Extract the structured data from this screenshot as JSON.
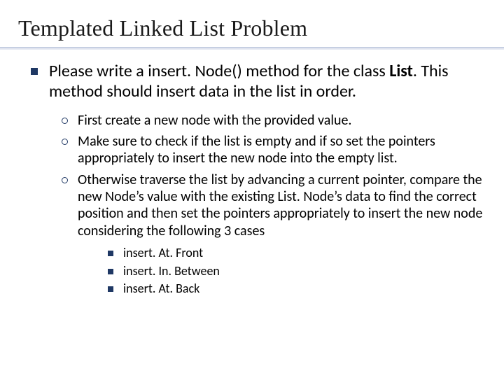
{
  "title": "Templated Linked List Problem",
  "intro_pre": "Please write a insert. Node() method for the class ",
  "intro_bold": "List",
  "intro_post": ". This method should insert data in the list in order.",
  "sub": {
    "a": "First create a new node with the provided value.",
    "b": "Make sure to check if the list is empty and if so set the pointers appropriately to insert the new node into the empty list.",
    "c": "Otherwise traverse the list by advancing a current pointer, compare the new Node’s value with the existing List. Node’s data to find the correct position and then set the pointers appropriately to insert the new node considering the following 3 cases"
  },
  "cases": {
    "a": "insert. At. Front",
    "b": "insert. In. Between",
    "c": "insert. At. Back"
  }
}
